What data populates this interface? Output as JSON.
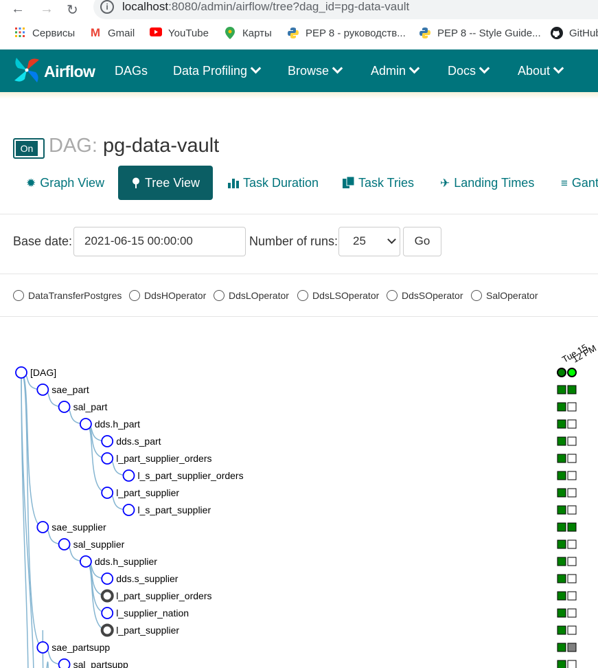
{
  "browser": {
    "url_host": "localhost",
    "url_rest": ":8080/admin/airflow/tree?dag_id=pg-data-vault",
    "bookmarks": [
      {
        "label": "Сервисы",
        "icon": "apps-grid-icon"
      },
      {
        "label": "Gmail",
        "icon": "gmail-icon"
      },
      {
        "label": "YouTube",
        "icon": "youtube-icon"
      },
      {
        "label": "Карты",
        "icon": "maps-pin-icon"
      },
      {
        "label": "PEP 8 - руководств...",
        "icon": "python-icon"
      },
      {
        "label": "PEP 8 -- Style Guide...",
        "icon": "python-icon"
      },
      {
        "label": "GitHub",
        "icon": "github-icon"
      }
    ]
  },
  "navbar": {
    "brand": "Airflow",
    "items": [
      {
        "label": "DAGs",
        "dropdown": false
      },
      {
        "label": "Data Profiling",
        "dropdown": true
      },
      {
        "label": "Browse",
        "dropdown": true
      },
      {
        "label": "Admin",
        "dropdown": true
      },
      {
        "label": "Docs",
        "dropdown": true
      },
      {
        "label": "About",
        "dropdown": true
      }
    ]
  },
  "dag": {
    "toggle_label": "On",
    "title_prefix": "DAG:",
    "name": "pg-data-vault"
  },
  "tabs": [
    {
      "label": "Graph View",
      "icon": "graph-icon",
      "active": false
    },
    {
      "label": "Tree View",
      "icon": "tree-icon",
      "active": true
    },
    {
      "label": "Task Duration",
      "icon": "bar-chart-icon",
      "active": false
    },
    {
      "label": "Task Tries",
      "icon": "files-icon",
      "active": false
    },
    {
      "label": "Landing Times",
      "icon": "plane-icon",
      "active": false
    },
    {
      "label": "Gantt",
      "icon": "gantt-icon",
      "active": false
    }
  ],
  "form": {
    "base_date_label": "Base date:",
    "base_date_value": "2021-06-15 00:00:00",
    "num_runs_label": "Number of runs:",
    "num_runs_value": "25",
    "go_label": "Go"
  },
  "operators": [
    "DataTransferPostgres",
    "DdsHOperator",
    "DdsLOperator",
    "DdsLSOperator",
    "DdsSOperator",
    "SalOperator"
  ],
  "run_dates": [
    "Tue 15",
    "12 PM"
  ],
  "colors": {
    "success": "#008000",
    "running": "#00ff00",
    "upstream_failed_or_none": "#ffffff",
    "skipped": "#808080",
    "teal": "#00747c"
  },
  "tree": {
    "dag_root": "[DAG]",
    "nodes": [
      {
        "name": "sae_part",
        "depth": 1,
        "bold": false,
        "status": [
          "success",
          "success"
        ]
      },
      {
        "name": "sal_part",
        "depth": 2,
        "bold": false,
        "status": [
          "success",
          "none"
        ]
      },
      {
        "name": "dds.h_part",
        "depth": 3,
        "bold": false,
        "status": [
          "success",
          "none"
        ]
      },
      {
        "name": "dds.s_part",
        "depth": 4,
        "bold": false,
        "status": [
          "success",
          "none"
        ]
      },
      {
        "name": "l_part_supplier_orders",
        "depth": 4,
        "bold": false,
        "status": [
          "success",
          "none"
        ]
      },
      {
        "name": "l_s_part_supplier_orders",
        "depth": 5,
        "bold": false,
        "status": [
          "success",
          "none"
        ]
      },
      {
        "name": "l_part_supplier",
        "depth": 4,
        "bold": false,
        "status": [
          "success",
          "none"
        ]
      },
      {
        "name": "l_s_part_supplier",
        "depth": 5,
        "bold": false,
        "status": [
          "success",
          "none"
        ]
      },
      {
        "name": "sae_supplier",
        "depth": 1,
        "bold": false,
        "status": [
          "success",
          "success"
        ]
      },
      {
        "name": "sal_supplier",
        "depth": 2,
        "bold": false,
        "status": [
          "success",
          "none"
        ]
      },
      {
        "name": "dds.h_supplier",
        "depth": 3,
        "bold": false,
        "status": [
          "success",
          "none"
        ]
      },
      {
        "name": "dds.s_supplier",
        "depth": 4,
        "bold": false,
        "status": [
          "success",
          "none"
        ]
      },
      {
        "name": "l_part_supplier_orders",
        "depth": 4,
        "bold": true,
        "status": [
          "success",
          "none"
        ]
      },
      {
        "name": "l_supplier_nation",
        "depth": 4,
        "bold": false,
        "status": [
          "success",
          "none"
        ]
      },
      {
        "name": "l_part_supplier",
        "depth": 4,
        "bold": true,
        "status": [
          "success",
          "none"
        ]
      },
      {
        "name": "sae_partsupp",
        "depth": 1,
        "bold": false,
        "status": [
          "success",
          "skipped"
        ]
      },
      {
        "name": "sal_partsupp",
        "depth": 2,
        "bold": false,
        "status": [
          "success",
          "none"
        ]
      }
    ]
  }
}
